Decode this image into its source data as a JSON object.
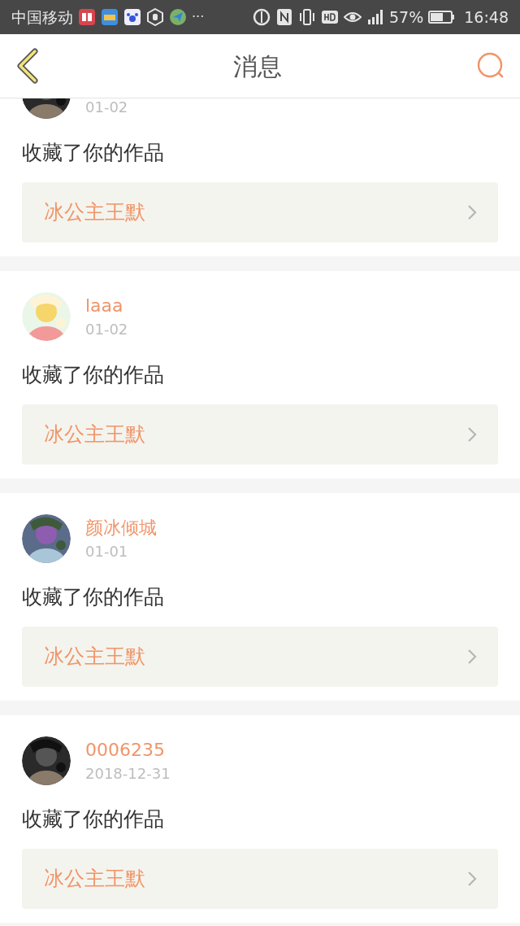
{
  "status_bar": {
    "carrier": "中国移动",
    "more": "···",
    "battery_percent": "57%",
    "time": "16:48"
  },
  "header": {
    "title": "消息"
  },
  "messages": [
    {
      "date": "01-02",
      "action": "收藏了你的作品",
      "work": "冰公主王默"
    },
    {
      "name": "laaa",
      "date": "01-02",
      "action": "收藏了你的作品",
      "work": "冰公主王默"
    },
    {
      "name": "颜冰倾城",
      "date": "01-01",
      "action": "收藏了你的作品",
      "work": "冰公主王默"
    },
    {
      "name": "0006235",
      "date": "2018-12-31",
      "action": "收藏了你的作品",
      "work": "冰公主王默"
    }
  ]
}
